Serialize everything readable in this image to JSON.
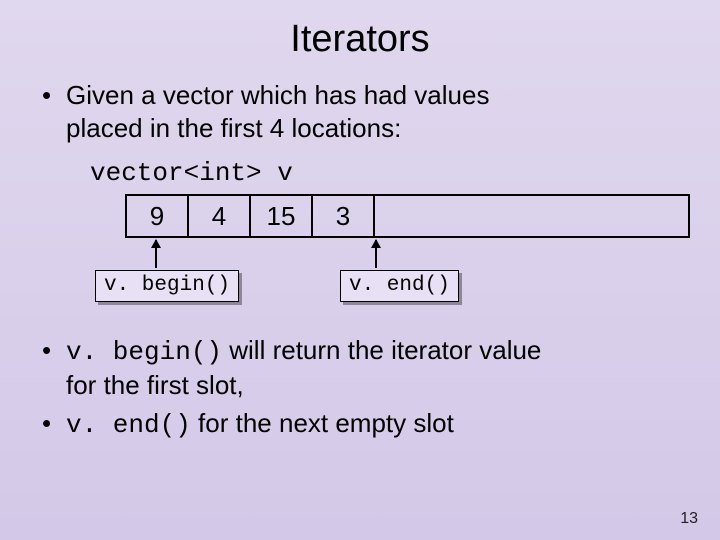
{
  "title": "Iterators",
  "bullet1_a": "Given a vector which has had values",
  "bullet1_b": "placed in the first 4 locations:",
  "vector_label": "vector<int> v",
  "cells": {
    "c0": "9",
    "c1": "4",
    "c2": "15",
    "c3": "3"
  },
  "labels": {
    "begin": "v. begin()",
    "end": "v. end()"
  },
  "bullet2_code": "v. begin()",
  "bullet2_text_a": " will return the iterator value",
  "bullet2_text_b": "for the first slot,",
  "bullet3_code": "v. end()",
  "bullet3_text": " for the next empty slot",
  "page": "13"
}
